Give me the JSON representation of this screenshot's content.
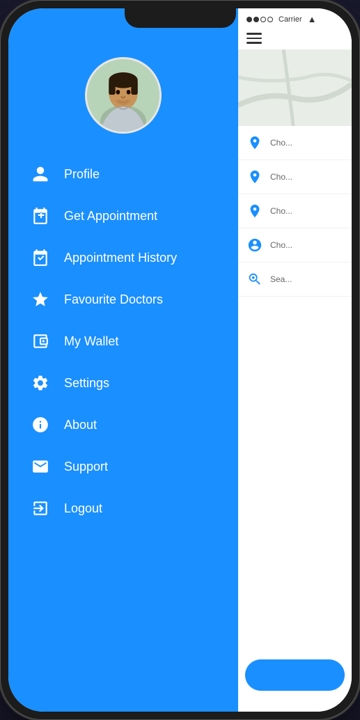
{
  "phone": {
    "notch": true
  },
  "statusBar": {
    "signal": [
      "filled",
      "filled",
      "empty",
      "empty"
    ],
    "carrier": "Carrier",
    "wifi": "wifi"
  },
  "sidebar": {
    "menuItems": [
      {
        "id": "profile",
        "label": "Profile",
        "icon": "person"
      },
      {
        "id": "get-appointment",
        "label": "Get Appointment",
        "icon": "calendar-plus"
      },
      {
        "id": "appointment-history",
        "label": "Appointment History",
        "icon": "calendar-check"
      },
      {
        "id": "favourite-doctors",
        "label": "Favourite Doctors",
        "icon": "star"
      },
      {
        "id": "my-wallet",
        "label": "My Wallet",
        "icon": "wallet"
      },
      {
        "id": "settings",
        "label": "Settings",
        "icon": "gear"
      },
      {
        "id": "about",
        "label": "About",
        "icon": "info"
      },
      {
        "id": "support",
        "label": "Support",
        "icon": "envelope"
      },
      {
        "id": "logout",
        "label": "Logout",
        "icon": "logout"
      }
    ]
  },
  "rightPanel": {
    "locationItems": [
      {
        "label": "Cho",
        "iconType": "person-location"
      },
      {
        "label": "Cho",
        "iconType": "pin"
      },
      {
        "label": "Cho",
        "iconType": "pin"
      },
      {
        "label": "Cho",
        "iconType": "person-circle"
      },
      {
        "label": "Sea",
        "iconType": "search-person"
      }
    ]
  }
}
